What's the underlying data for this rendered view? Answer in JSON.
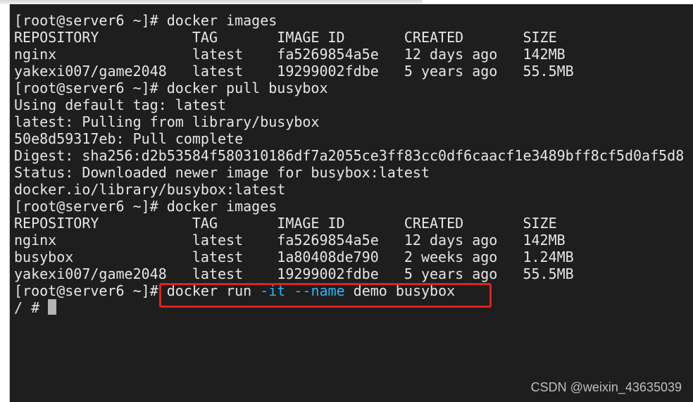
{
  "terminal": {
    "prompt": "[root@server6 ~]#",
    "lines": [
      {
        "text": "[root@server6 ~]# docker images"
      },
      {
        "text": "REPOSITORY           TAG       IMAGE ID       CREATED       SIZE"
      },
      {
        "text": "nginx                latest    fa5269854a5e   12 days ago   142MB"
      },
      {
        "text": "yakexi007/game2048   latest    19299002fdbe   5 years ago   55.5MB"
      },
      {
        "text": "[root@server6 ~]# docker pull busybox"
      },
      {
        "text": "Using default tag: latest"
      },
      {
        "text": "latest: Pulling from library/busybox"
      },
      {
        "text": "50e8d59317eb: Pull complete"
      },
      {
        "text": "Digest: sha256:d2b53584f580310186df7a2055ce3ff83cc0df6caacf1e3489bff8cf5d0af5d8"
      },
      {
        "text": "Status: Downloaded newer image for busybox:latest"
      },
      {
        "text": "docker.io/library/busybox:latest"
      },
      {
        "text": "[root@server6 ~]# docker images"
      },
      {
        "text": "REPOSITORY           TAG       IMAGE ID       CREATED       SIZE"
      },
      {
        "text": "nginx                latest    fa5269854a5e   12 days ago   142MB"
      },
      {
        "text": "busybox              latest    1a80408de790   2 weeks ago   1.24MB"
      },
      {
        "text": "yakexi007/game2048   latest    19299002fdbe   5 years ago   55.5MB"
      }
    ],
    "run_line": {
      "prompt": "[root@server6 ~]#",
      "cmd1": " docker run ",
      "flag1": "-it",
      "space": " ",
      "flag2": "--name",
      "cmd2": " demo busybox"
    },
    "shell_prompt": "/ # "
  },
  "watermark": "CSDN @weixin_43635039",
  "colors": {
    "terminal_bg": "#1e1e1e",
    "text": "#e6e6e6",
    "flag_cyan": "#29b6f6",
    "highlight_red": "#e3211c"
  }
}
